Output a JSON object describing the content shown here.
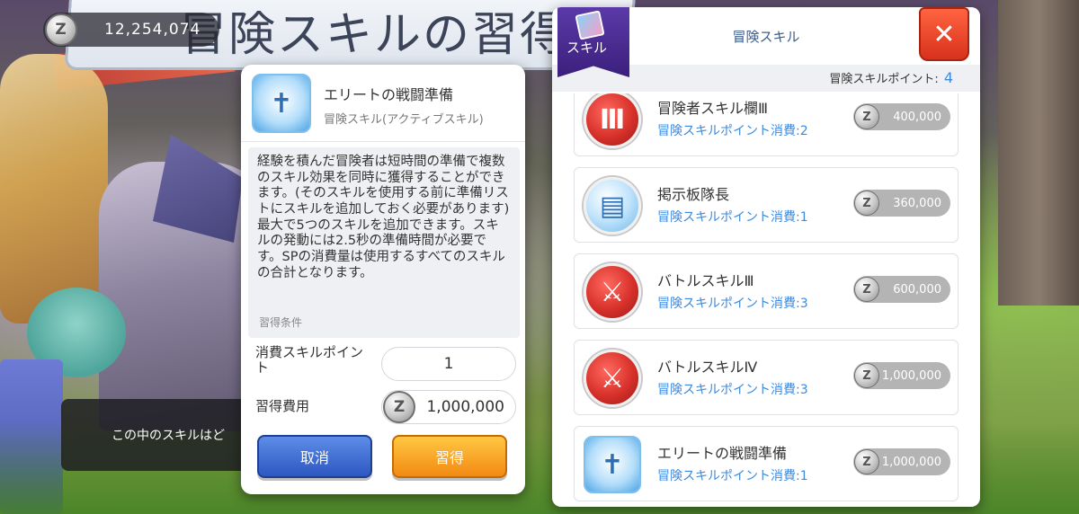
{
  "currency": {
    "icon": "zeny-coin-icon",
    "coin_symbol": "Z",
    "amount": "12,254,074"
  },
  "background_title": "冒険スキルの習得",
  "hint_text": "この中のスキルはど",
  "detail": {
    "skill_name": "エリートの戦闘準備",
    "skill_type": "冒険スキル(アクティブスキル)",
    "description": "経験を積んだ冒険者は短時間の準備で複数のスキル効果を同時に獲得することができます。(そのスキルを使用する前に準備リストにスキルを追加しておく必要があります)最大で5つのスキルを追加できます。スキルの発動には2.5秒の準備時間が必要です。SPの消費量は使用するすべてのスキルの合計となります。",
    "conditions_label": "習得条件",
    "skill_point_label": "消費スキルポイント",
    "skill_point_value": "1",
    "cost_label": "習得費用",
    "cost_value": "1,000,000",
    "cancel_label": "取消",
    "learn_label": "習得"
  },
  "panel": {
    "badge_label": "スキル",
    "title": "冒険スキル",
    "points_label": "冒険スキルポイント:",
    "points_value": "4",
    "close_symbol": "✕",
    "skills": [
      {
        "name": "冒険者スキル欄Ⅲ",
        "points": "冒険スキルポイント消費:2",
        "cost": "400,000",
        "icon": "crossed-swords-iii-icon",
        "glyph": "Ⅲ"
      },
      {
        "name": "掲示板隊長",
        "points": "冒険スキルポイント消費:1",
        "cost": "360,000",
        "icon": "bulletin-board-icon",
        "glyph": "▤"
      },
      {
        "name": "バトルスキルⅢ",
        "points": "冒険スキルポイント消費:3",
        "cost": "600,000",
        "icon": "battle-swords-icon",
        "glyph": "⚔"
      },
      {
        "name": "バトルスキルⅣ",
        "points": "冒険スキルポイント消費:3",
        "cost": "1,000,000",
        "icon": "battle-swords-iv-icon",
        "glyph": "⚔"
      },
      {
        "name": "エリートの戦闘準備",
        "points": "冒険スキルポイント消費:1",
        "cost": "1,000,000",
        "icon": "elite-prep-icon",
        "glyph": "✝"
      }
    ]
  }
}
